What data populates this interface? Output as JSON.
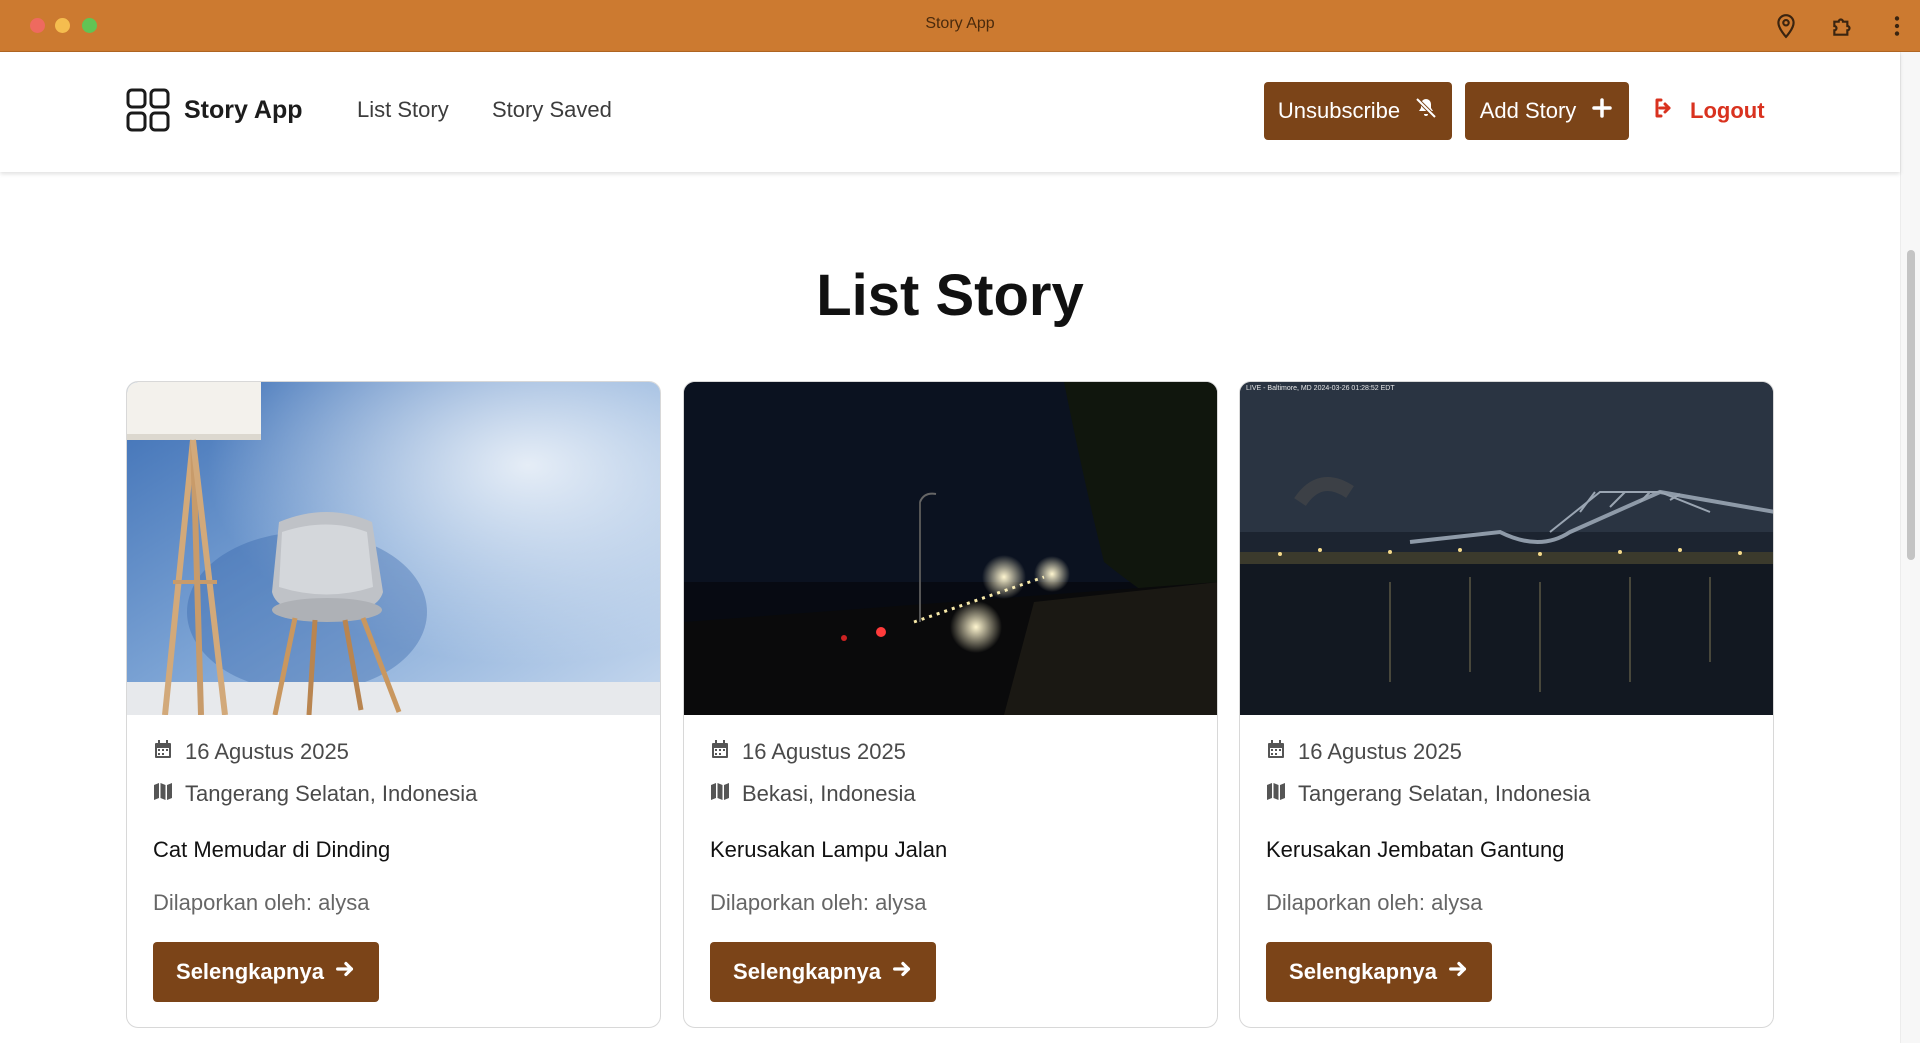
{
  "window": {
    "title": "Story App"
  },
  "navbar": {
    "brand": "Story App",
    "links": [
      "List Story",
      "Story Saved"
    ],
    "unsubscribe_label": "Unsubscribe",
    "add_story_label": "Add Story",
    "logout_label": "Logout"
  },
  "main": {
    "title": "List Story",
    "stories": [
      {
        "date": "16 Agustus 2025",
        "location": "Tangerang Selatan, Indonesia",
        "title": "Cat Memudar di Dinding",
        "reporter": "Dilaporkan oleh: alysa",
        "button": "Selengkapnya",
        "image": "chair-lamp-blue-wall"
      },
      {
        "date": "16 Agustus 2025",
        "location": "Bekasi, Indonesia",
        "title": "Kerusakan Lampu Jalan",
        "reporter": "Dilaporkan oleh: alysa",
        "button": "Selengkapnya",
        "image": "night-road-lights"
      },
      {
        "date": "16 Agustus 2025",
        "location": "Tangerang Selatan, Indonesia",
        "title": "Kerusakan Jembatan Gantung",
        "reporter": "Dilaporkan oleh: alysa",
        "button": "Selengkapnya",
        "image": "collapsed-bridge-night",
        "image_overlay_text": "LIVE - Baltimore, MD 2024-03-26 01:28:52 EDT"
      }
    ]
  },
  "colors": {
    "titlebar": "#cc7a30",
    "primary_button": "#7b4418",
    "logout": "#d9321f"
  },
  "icons": [
    "location-pin-icon",
    "extensions-icon",
    "more-vert-icon",
    "grid-logo-icon",
    "bell-slash-icon",
    "plus-icon",
    "sign-out-icon",
    "calendar-icon",
    "map-icon",
    "arrow-right-icon"
  ]
}
